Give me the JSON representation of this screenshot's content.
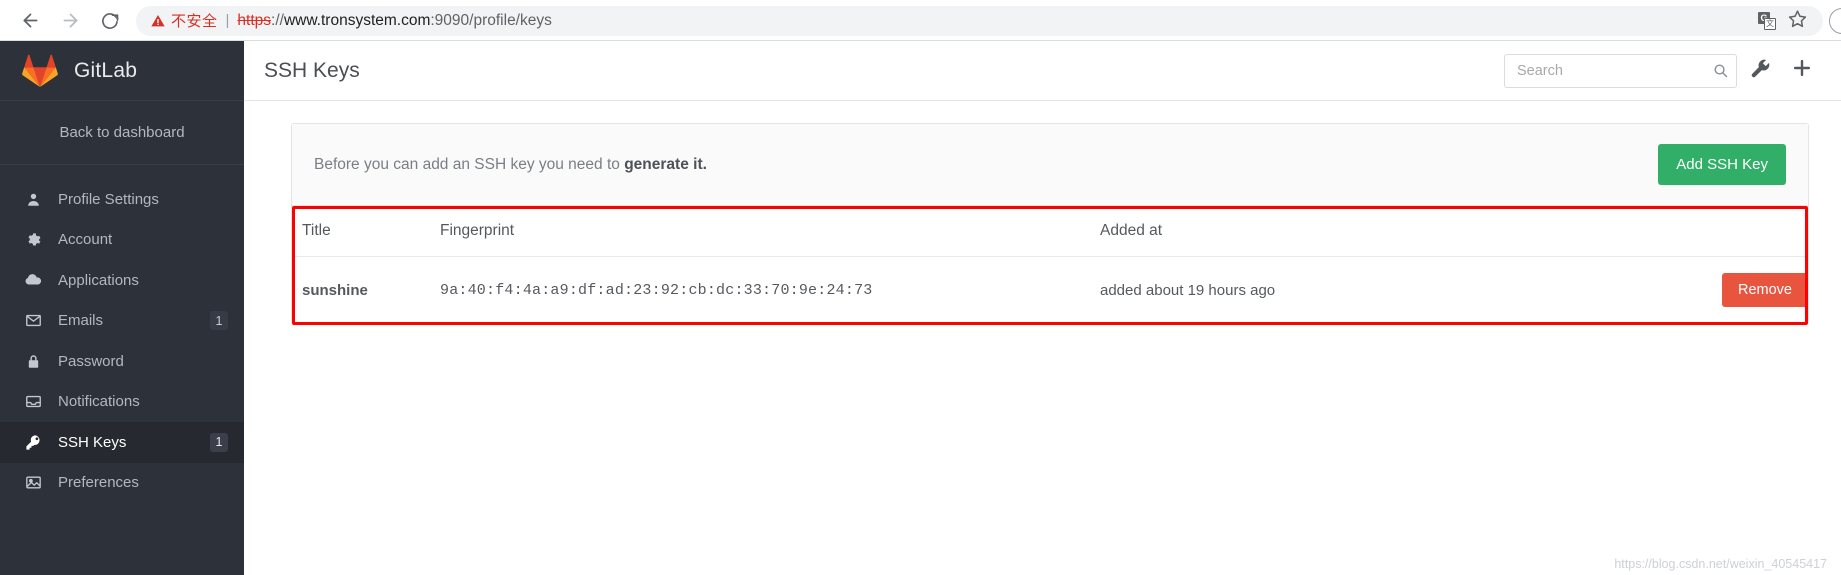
{
  "browser": {
    "back_icon": "arrow-left-icon",
    "forward_icon": "arrow-right-icon",
    "reload_icon": "reload-icon",
    "security_label": "不安全",
    "security_divider": "|",
    "url_scheme": "https",
    "url_separator": "://",
    "url_host": "www.tronsystem.com",
    "url_path": ":9090/profile/keys",
    "translate_icon": "translate-icon",
    "translate_g": "G",
    "translate_sub": "文",
    "bookmark_icon": "star-icon",
    "profile_icon": "account-circle-icon"
  },
  "sidebar": {
    "brand": "GitLab",
    "brand_logo": "gitlab-tanuki-logo",
    "back_to_dashboard": "Back to dashboard",
    "items": [
      {
        "label": "Profile Settings",
        "icon": "user-icon",
        "badge": "",
        "active": false
      },
      {
        "label": "Account",
        "icon": "gear-icon",
        "badge": "",
        "active": false
      },
      {
        "label": "Applications",
        "icon": "cloud-icon",
        "badge": "",
        "active": false
      },
      {
        "label": "Emails",
        "icon": "envelope-icon",
        "badge": "1",
        "active": false
      },
      {
        "label": "Password",
        "icon": "lock-icon",
        "badge": "",
        "active": false
      },
      {
        "label": "Notifications",
        "icon": "inbox-icon",
        "badge": "",
        "active": false
      },
      {
        "label": "SSH Keys",
        "icon": "key-icon",
        "badge": "1",
        "active": true
      },
      {
        "label": "Preferences",
        "icon": "image-icon",
        "badge": "",
        "active": false
      }
    ]
  },
  "header": {
    "title": "SSH Keys",
    "search_placeholder": "Search",
    "search_value": "",
    "search_icon": "search-icon",
    "wrench_icon": "wrench-icon",
    "plus_icon": "plus-icon"
  },
  "notice": {
    "text_before": "Before you can add an SSH key you need to ",
    "link_text": "generate it.",
    "add_button": "Add SSH Key"
  },
  "table": {
    "columns": [
      "Title",
      "Fingerprint",
      "Added at",
      ""
    ],
    "rows": [
      {
        "title": "sunshine",
        "fingerprint": "9a:40:f4:4a:a9:df:ad:23:92:cb:dc:33:70:9e:24:73",
        "added_at": "added about 19 hours ago",
        "action": "Remove"
      }
    ]
  },
  "watermark": "https://blog.csdn.net/weixin_40545417",
  "colors": {
    "sidebar_bg": "#2d3139",
    "sidebar_active": "#26292f",
    "add_button": "#31af69",
    "remove_button": "#e9543f",
    "highlight_outline": "#ff0000",
    "security_red": "#d93025"
  }
}
